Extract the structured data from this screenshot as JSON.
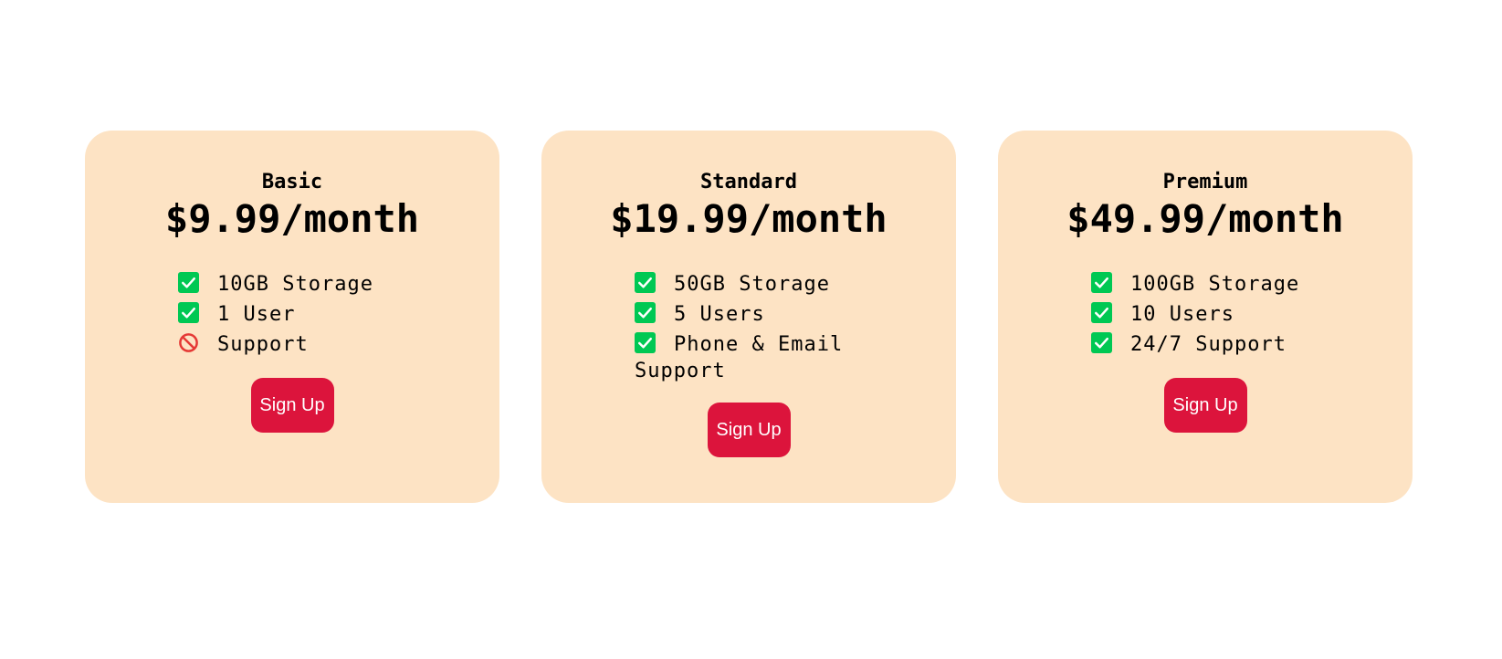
{
  "plans": [
    {
      "name": "Basic",
      "price": "$9.99/month",
      "features": [
        {
          "icon": "check-icon",
          "text": "10GB Storage"
        },
        {
          "icon": "check-icon",
          "text": "1 User"
        },
        {
          "icon": "prohibited-icon",
          "text": "Support"
        }
      ],
      "button_label": "Sign Up"
    },
    {
      "name": "Standard",
      "price": "$19.99/month",
      "features": [
        {
          "icon": "check-icon",
          "text": "50GB Storage"
        },
        {
          "icon": "check-icon",
          "text": "5 Users"
        },
        {
          "icon": "check-icon",
          "text": "Phone & Email Support"
        }
      ],
      "button_label": "Sign Up"
    },
    {
      "name": "Premium",
      "price": "$49.99/month",
      "features": [
        {
          "icon": "check-icon",
          "text": "100GB Storage"
        },
        {
          "icon": "check-icon",
          "text": "10 Users"
        },
        {
          "icon": "check-icon",
          "text": "24/7 Support"
        }
      ],
      "button_label": "Sign Up"
    }
  ],
  "colors": {
    "card_background": "#fde3c4",
    "button_background": "#dc143c",
    "button_text": "#ffffff",
    "check_green": "#00c853",
    "prohibited_red": "#e53935"
  }
}
